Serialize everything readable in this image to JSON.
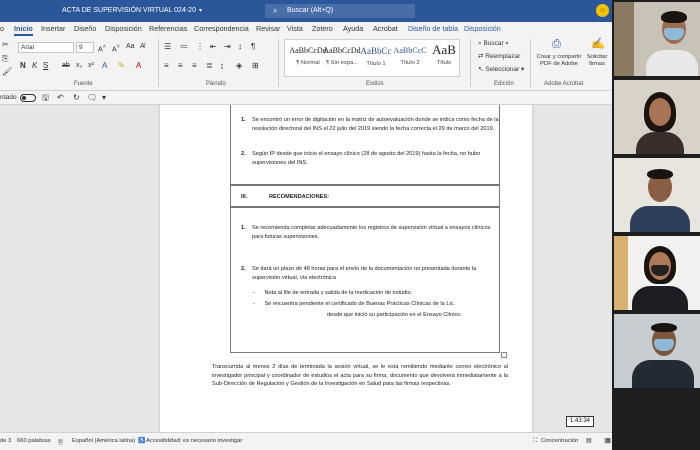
{
  "titlebar": {
    "doc_title": "ACTA DE SUPERVISIÓN VIRTUAL 024-20",
    "search_placeholder": "Buscar (Alt+Q)"
  },
  "menu_tabs": [
    "o",
    "Inicio",
    "Insertar",
    "Diseño",
    "Disposición",
    "Referencias",
    "Correspondencia",
    "Revisar",
    "Vista",
    "Zotero",
    "Ayuda",
    "Acrobat",
    "Diseño de tabla",
    "Disposición"
  ],
  "ribbon": {
    "font_name": "Arial",
    "font_size": "9",
    "styles": [
      {
        "sample": "AaBbCcDd",
        "name": "¶ Normal"
      },
      {
        "sample": "AaBbCcDd",
        "name": "¶ Sin espa..."
      },
      {
        "sample": "AaBbCc",
        "name": "Título 1"
      },
      {
        "sample": "AaBbCcC",
        "name": "Título 2"
      },
      {
        "sample": "AaB",
        "name": "Título"
      }
    ],
    "editing": {
      "find": "Buscar",
      "replace": "Reemplazar",
      "select": "Seleccionar"
    },
    "acrobat": {
      "create_share": "Crear y compartir PDF de Adobe",
      "request": "Solicitar firmas"
    },
    "group_labels": {
      "font": "Fuente",
      "paragraph": "Párrafo",
      "styles": "Estilos",
      "editing": "Edición",
      "acrobat": "Adobe Acrobat"
    }
  },
  "quick_access": {
    "autosave_label": "rdado"
  },
  "document": {
    "section2_items": [
      {
        "num": "1.",
        "text": "Se encontró un error de digitación en la matriz de autoevaluación donde se indica como fecha de la resolución directoral del INS el 22 julio del 2019 siendo la fecha correcta el 29 de marzo del 2019."
      },
      {
        "num": "2.",
        "text": "Según IP desde que inicio el ensayo clínico (28 de agosto del 2019) hasta la fecha, no hubo supervisiones del INS."
      }
    ],
    "section3_num": "III.",
    "section3_title": "RECOMENDACIONES:",
    "recommendations": [
      {
        "num": "1.",
        "text": "Se recomienda completar adecuadamente los registros de supervisión virtual a ensayos clínicos para futuras supervisiones."
      },
      {
        "num": "2.",
        "text": "Se dará un plazo de 48 horas para el envío de la documentación no presentada durante la supervisión virtual, vía electrónica"
      }
    ],
    "sub_items": [
      "Nota al file de entrada y salida de la medicación de estudio.",
      "Se encuentra pendiente el certificado de Buenas Prácticas Clínicas de la Lic."
    ],
    "sub_item_continuation": "desde que inició su participación en el Ensayo Clínico.",
    "closing_paragraph": "Transcurrida al menos 2 días de terminada la sesión virtual, se le está remitiendo mediante correo electrónico al investigador principal y coordinador de estudios el acta para su firma, documento que devolverá inmediatamente a la Sub-Dirección de Regulación y Gestión de la Investigación en Salud para las firmas respectivas."
  },
  "statusbar": {
    "page": "de 3",
    "words": "660 palabras",
    "language": "Español (América latina)",
    "accessibility": "Accesibilidad: es necesario investigar",
    "focus": "Concentración"
  },
  "timer": "1:43:34"
}
